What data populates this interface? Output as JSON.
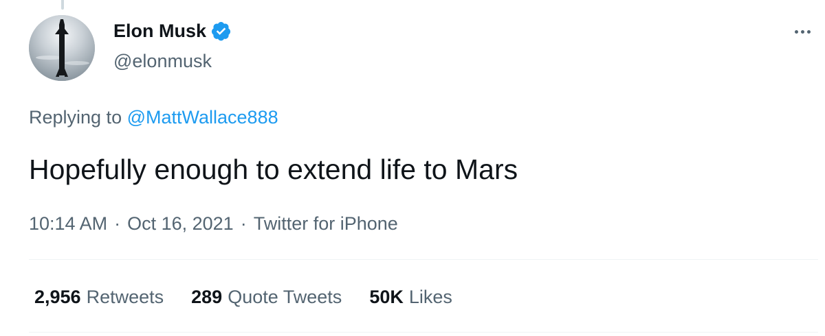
{
  "author": {
    "display_name": "Elon Musk",
    "handle": "@elonmusk",
    "verified": true,
    "avatar_icon": "starship-avatar"
  },
  "reply": {
    "prefix": "Replying to",
    "mention": "@MattWallace888"
  },
  "tweet": {
    "text": "Hopefully enough to extend life to Mars"
  },
  "meta": {
    "time": "10:14 AM",
    "date": "Oct 16, 2021",
    "source": "Twitter for iPhone",
    "separator": "·"
  },
  "stats": [
    {
      "count": "2,956",
      "label": "Retweets"
    },
    {
      "count": "289",
      "label": "Quote Tweets"
    },
    {
      "count": "50K",
      "label": "Likes"
    }
  ],
  "colors": {
    "accent": "#1d9bf0",
    "text_primary": "#0f1419",
    "text_secondary": "#536471",
    "divider": "#eff3f4"
  },
  "icons": {
    "verified": "verified-badge-icon",
    "more": "more-options-icon"
  }
}
